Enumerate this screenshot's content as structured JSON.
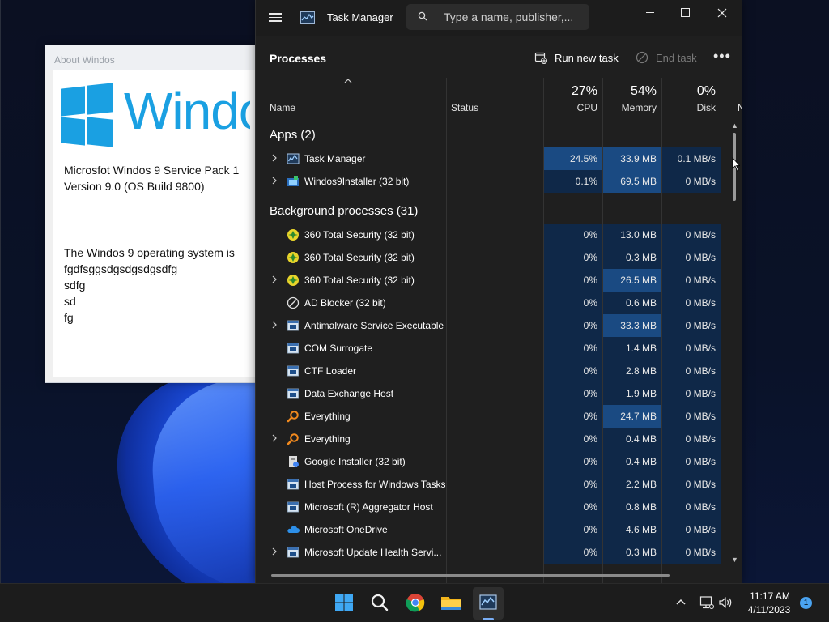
{
  "about_window": {
    "title": "About Windos",
    "logo_text": "Windo",
    "line1": "Microsfot Windos 9 Service Pack 1",
    "line2": "Version 9.0 (OS Build 9800)",
    "desc_lines": [
      "The Windos 9 operating system is",
      "fgdfsggsdgsdgsdgsdfg",
      "sdfg",
      "sd",
      "fg"
    ]
  },
  "task_manager": {
    "title": "Task Manager",
    "search_placeholder": "Type a name, publisher,...",
    "page_title": "Processes",
    "run_new_task": "Run new task",
    "end_task": "End task",
    "more_glyph": "•••",
    "columns": {
      "name": "Name",
      "status": "Status",
      "cpu_pct": "27%",
      "cpu": "CPU",
      "memory_pct": "54%",
      "memory": "Memory",
      "disk_pct": "0%",
      "disk": "Disk",
      "network_partial": "N"
    },
    "groups": {
      "apps": "Apps (2)",
      "background": "Background processes (31)"
    },
    "apps": [
      {
        "name": "Task Manager",
        "icon": "task-manager-icon",
        "expandable": true,
        "cpu": "24.5%",
        "memory": "33.9 MB",
        "disk": "0.1 MB/s"
      },
      {
        "name": "Windos9Installer (32 bit)",
        "icon": "installer-icon",
        "expandable": true,
        "cpu": "0.1%",
        "memory": "69.5 MB",
        "disk": "0 MB/s"
      }
    ],
    "background": [
      {
        "name": "360 Total Security (32 bit)",
        "icon": "360-security-icon",
        "expandable": false,
        "cpu": "0%",
        "memory": "13.0 MB",
        "disk": "0 MB/s"
      },
      {
        "name": "360 Total Security (32 bit)",
        "icon": "360-security-icon",
        "expandable": false,
        "cpu": "0%",
        "memory": "0.3 MB",
        "disk": "0 MB/s"
      },
      {
        "name": "360 Total Security (32 bit)",
        "icon": "360-security-icon",
        "expandable": true,
        "cpu": "0%",
        "memory": "26.5 MB",
        "disk": "0 MB/s"
      },
      {
        "name": "AD Blocker (32 bit)",
        "icon": "ad-blocker-icon",
        "expandable": false,
        "cpu": "0%",
        "memory": "0.6 MB",
        "disk": "0 MB/s"
      },
      {
        "name": "Antimalware Service Executable",
        "icon": "service-window-icon",
        "expandable": true,
        "cpu": "0%",
        "memory": "33.3 MB",
        "disk": "0 MB/s"
      },
      {
        "name": "COM Surrogate",
        "icon": "service-window-icon",
        "expandable": false,
        "cpu": "0%",
        "memory": "1.4 MB",
        "disk": "0 MB/s"
      },
      {
        "name": "CTF Loader",
        "icon": "service-window-icon",
        "expandable": false,
        "cpu": "0%",
        "memory": "2.8 MB",
        "disk": "0 MB/s"
      },
      {
        "name": "Data Exchange Host",
        "icon": "service-window-icon",
        "expandable": false,
        "cpu": "0%",
        "memory": "1.9 MB",
        "disk": "0 MB/s"
      },
      {
        "name": "Everything",
        "icon": "everything-search-icon",
        "expandable": false,
        "cpu": "0%",
        "memory": "24.7 MB",
        "disk": "0 MB/s"
      },
      {
        "name": "Everything",
        "icon": "everything-search-icon",
        "expandable": true,
        "cpu": "0%",
        "memory": "0.4 MB",
        "disk": "0 MB/s"
      },
      {
        "name": "Google Installer (32 bit)",
        "icon": "google-installer-icon",
        "expandable": false,
        "cpu": "0%",
        "memory": "0.4 MB",
        "disk": "0 MB/s"
      },
      {
        "name": "Host Process for Windows Tasks",
        "icon": "service-window-icon",
        "expandable": false,
        "cpu": "0%",
        "memory": "2.2 MB",
        "disk": "0 MB/s"
      },
      {
        "name": "Microsoft (R) Aggregator Host",
        "icon": "service-window-icon",
        "expandable": false,
        "cpu": "0%",
        "memory": "0.8 MB",
        "disk": "0 MB/s"
      },
      {
        "name": "Microsoft OneDrive",
        "icon": "onedrive-icon",
        "expandable": false,
        "cpu": "0%",
        "memory": "4.6 MB",
        "disk": "0 MB/s"
      },
      {
        "name": "Microsoft Update Health Servi...",
        "icon": "service-window-icon",
        "expandable": true,
        "cpu": "0%",
        "memory": "0.3 MB",
        "disk": "0 MB/s"
      }
    ]
  },
  "taskbar": {
    "time": "11:17 AM",
    "date": "4/11/2023",
    "notification_count": "1",
    "icons": [
      "windows-start-icon",
      "search-icon",
      "chrome-icon",
      "file-explorer-icon",
      "task-manager-icon"
    ]
  },
  "colors": {
    "tm_bg": "#1f1f1f",
    "heat_dark": "#0f2848",
    "heat_mid": "#163a66",
    "heat_high": "#1a4a82",
    "logo_blue": "#1aa0e2",
    "accent": "#4aa3f0"
  }
}
